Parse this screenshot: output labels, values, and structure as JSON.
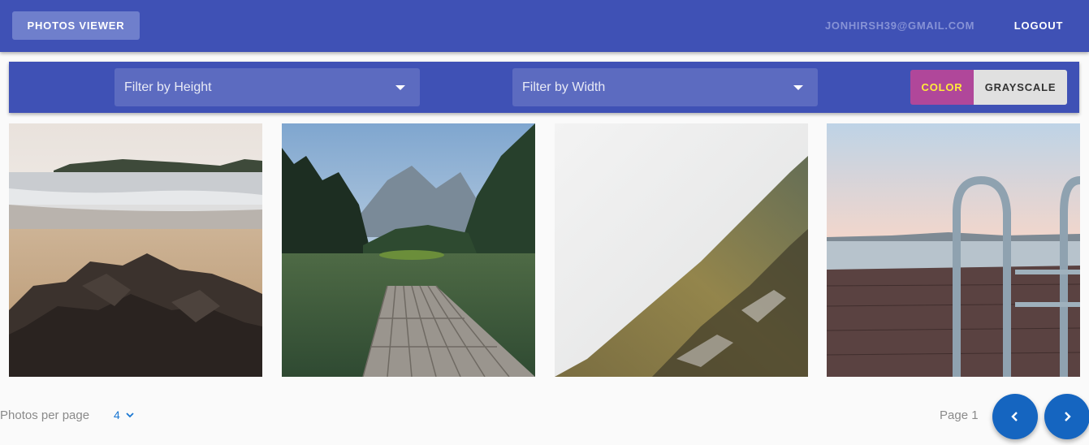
{
  "header": {
    "brand": "PHOTOS VIEWER",
    "user_email": "JONHIRSH39@GMAIL.COM",
    "logout": "LOGOUT"
  },
  "filters": {
    "height_placeholder": "Filter by Height",
    "width_placeholder": "Filter by Width",
    "color_toggle": {
      "color": "COLOR",
      "grayscale": "GRAYSCALE",
      "active": "COLOR"
    }
  },
  "photos": [
    {
      "subject": "beach-rocks"
    },
    {
      "subject": "lake-dock-mountains"
    },
    {
      "subject": "foggy-forest-slope"
    },
    {
      "subject": "pier-ladder"
    }
  ],
  "pagination": {
    "per_page_label": "Photos per page",
    "per_page_value": "4",
    "page_label": "Page 1"
  },
  "colors": {
    "primary": "#3f51b5",
    "accent": "#b0479a",
    "fab": "#1565c0"
  }
}
